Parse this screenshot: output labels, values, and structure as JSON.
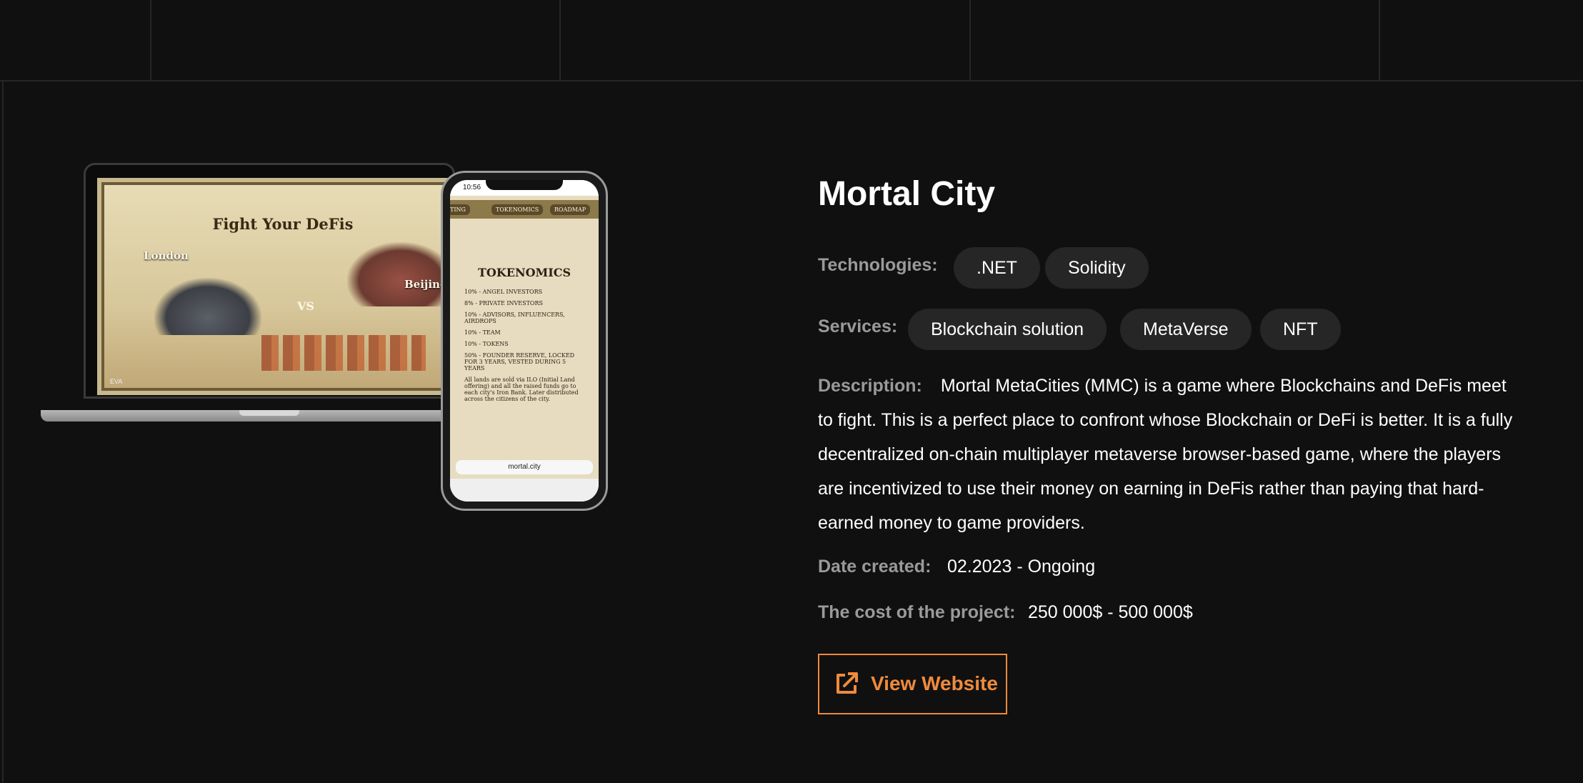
{
  "project": {
    "title": "Mortal City",
    "technologies_label": "Technologies:",
    "technologies": [
      ".NET",
      "Solidity"
    ],
    "services_label": "Services:",
    "services": [
      "Blockchain solution",
      "MetaVerse",
      "NFT"
    ],
    "description_label": "Description:",
    "description": "Mortal MetaCities (MMC) is a game where Blockchains and DeFis meet to fight. This is a perfect place to confront whose Blockchain or DeFi is better. It is a fully decentralized on-chain multiplayer metaverse browser-based game, where the players are incentivized to use their money on earning in DeFis rather than paying that hard-earned money to game providers.",
    "date_label": "Date created:",
    "date_value": "02.2023 - Ongoing",
    "cost_label": "The cost of the project:",
    "cost_value": "250 000$ - 500 000$",
    "view_website_label": "View Website",
    "view_website_icon": "external-link-icon",
    "accent_color": "#f08a3c"
  },
  "mockup": {
    "laptop_title": "Fight Your DeFis",
    "laptop_city_left": "London",
    "laptop_vs": "VS",
    "laptop_city_right": "Beijing",
    "laptop_footer": "EVA",
    "phone_time": "10:56",
    "phone_tabs": [
      "TING",
      "TOKENOMICS",
      "ROADMAP"
    ],
    "phone_title": "TOKENOMICS",
    "phone_items": [
      "10% - ANGEL INVESTORS",
      "8% - PRIVATE INVESTORS",
      "10% - ADVISORS, INFLUENCERS, AIRDROPS",
      "10% - TEAM",
      "10% - TOKENS",
      "50% - FOUNDER RESERVE, LOCKED FOR 3 YEARS, VESTED DURING 5 YEARS"
    ],
    "phone_note": "All lands are sold via ILO (Initial Land offering) and all the raised funds go to each city's Iron Bank. Later distributed across the citizens of the city.",
    "phone_url": "mortal.city"
  }
}
